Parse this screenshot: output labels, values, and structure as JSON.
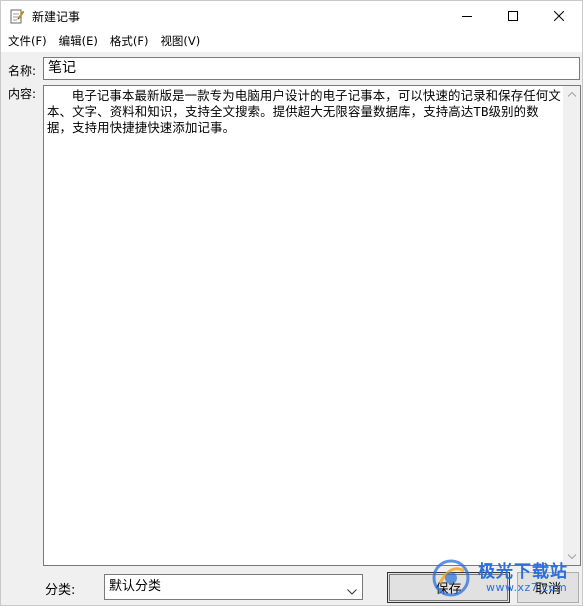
{
  "window": {
    "title": "新建记事",
    "icon": "notepad-edit-icon"
  },
  "menu": [
    {
      "label": "文件(F)"
    },
    {
      "label": "编辑(E)"
    },
    {
      "label": "格式(F)"
    },
    {
      "label": "视图(V)"
    }
  ],
  "form": {
    "name_label": "名称:",
    "name_value": "笔记",
    "content_label": "内容:",
    "content_value": "电子记事本最新版是一款专为电脑用户设计的电子记事本，可以快速的记录和保存任何文本、文字、资料和知识，支持全文搜索。提供超大无限容量数据库，支持高达TB级别的数据，支持用快捷捷快速添加记事。",
    "category_label": "分类:",
    "category_value": "默认分类"
  },
  "buttons": {
    "save": "保存",
    "cancel": "取消"
  },
  "watermark": {
    "text": "极光下载站",
    "sub": "www.xz7.com"
  },
  "colors": {
    "titlebar": "#ffffff",
    "window_bg": "#f0f0f0",
    "watermark": "#2a6fdb"
  }
}
